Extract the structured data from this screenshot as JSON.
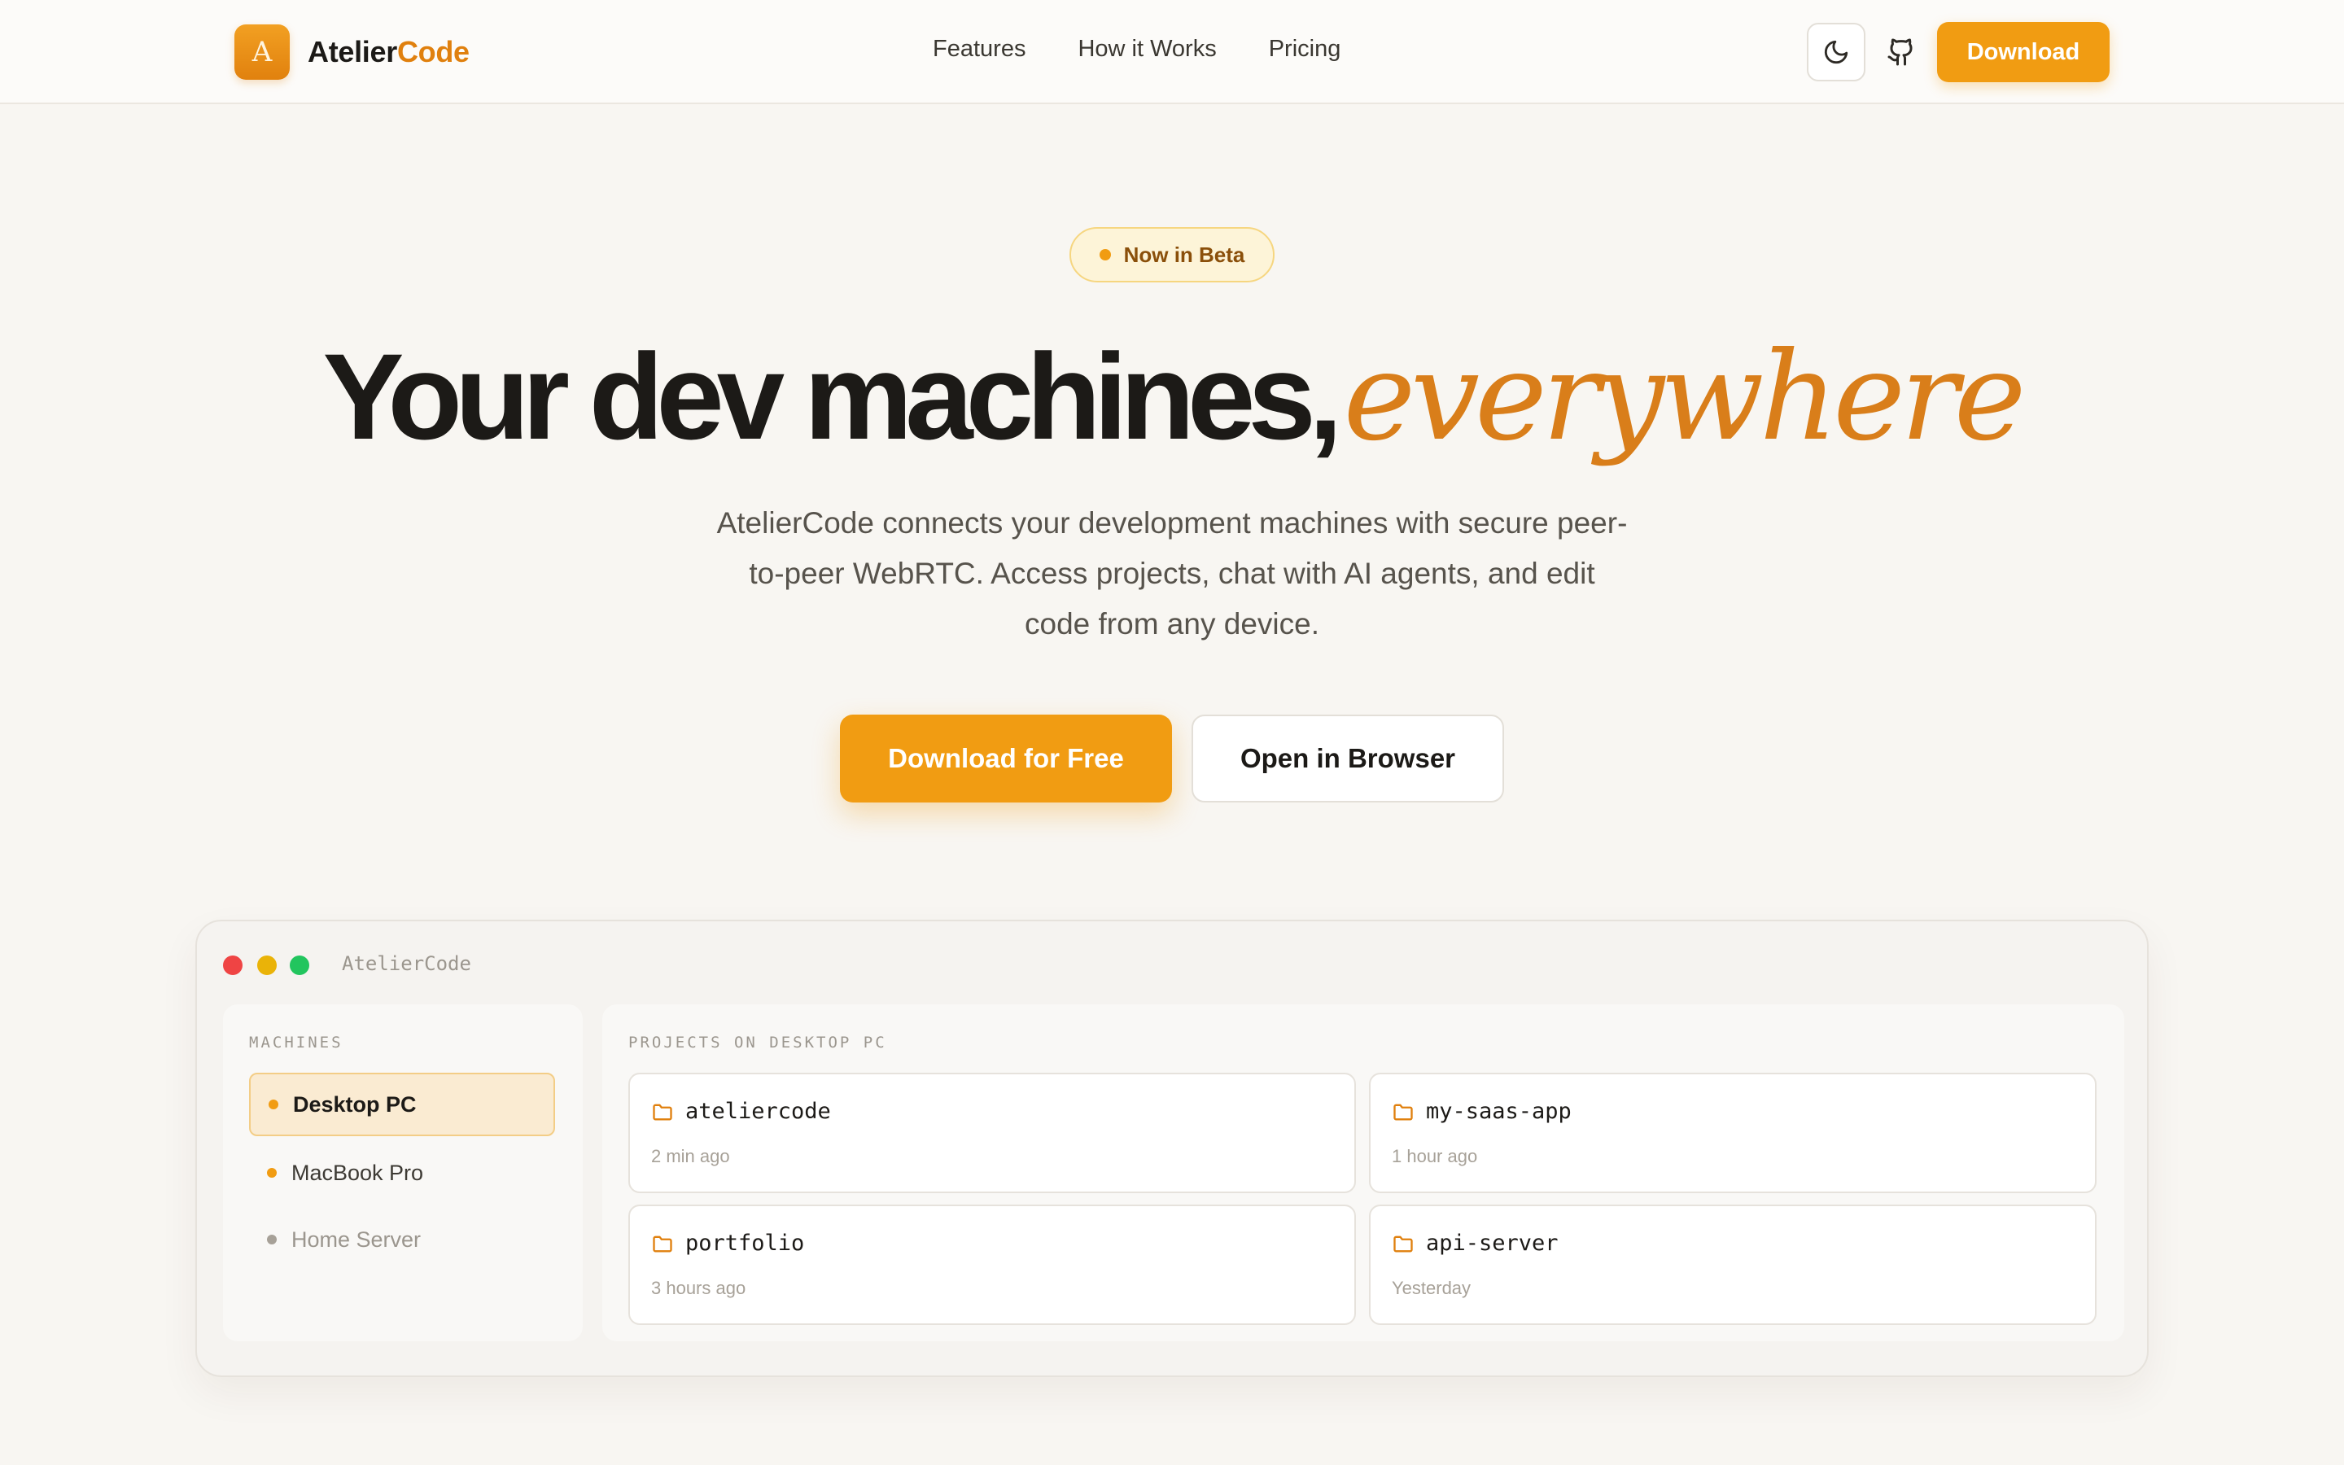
{
  "nav": {
    "brand_main": "Atelier",
    "brand_accent": "Code",
    "brand_mark": "A",
    "links": [
      "Features",
      "How it Works",
      "Pricing"
    ],
    "download_label": "Download",
    "theme_icon": "moon-icon",
    "github_icon": "github-icon"
  },
  "hero": {
    "badge": "Now in Beta",
    "headline_main": "Your dev machines,",
    "headline_accent": "everywhere",
    "subtitle": "AtelierCode connects your development machines with secure peer-to-peer WebRTC. Access projects, chat with AI agents, and edit code from any device.",
    "cta_primary": "Download for Free",
    "cta_secondary": "Open in Browser"
  },
  "app": {
    "title": "AtelierCode",
    "machines_label": "MACHINES",
    "machines": [
      {
        "name": "Desktop PC",
        "status": "online",
        "active": true
      },
      {
        "name": "MacBook Pro",
        "status": "online",
        "active": false
      },
      {
        "name": "Home Server",
        "status": "offline",
        "active": false
      }
    ],
    "projects_label": "PROJECTS ON DESKTOP PC",
    "projects": [
      {
        "name": "ateliercode",
        "time": "2 min ago"
      },
      {
        "name": "my-saas-app",
        "time": "1 hour ago"
      },
      {
        "name": "portfolio",
        "time": "3 hours ago"
      },
      {
        "name": "api-server",
        "time": "Yesterday"
      }
    ]
  },
  "colors": {
    "accent": "#f19c12",
    "accent_text": "#d97e1a",
    "background": "#f8f6f2",
    "online_dot": "#f19c12",
    "offline_dot": "#a7a198"
  }
}
